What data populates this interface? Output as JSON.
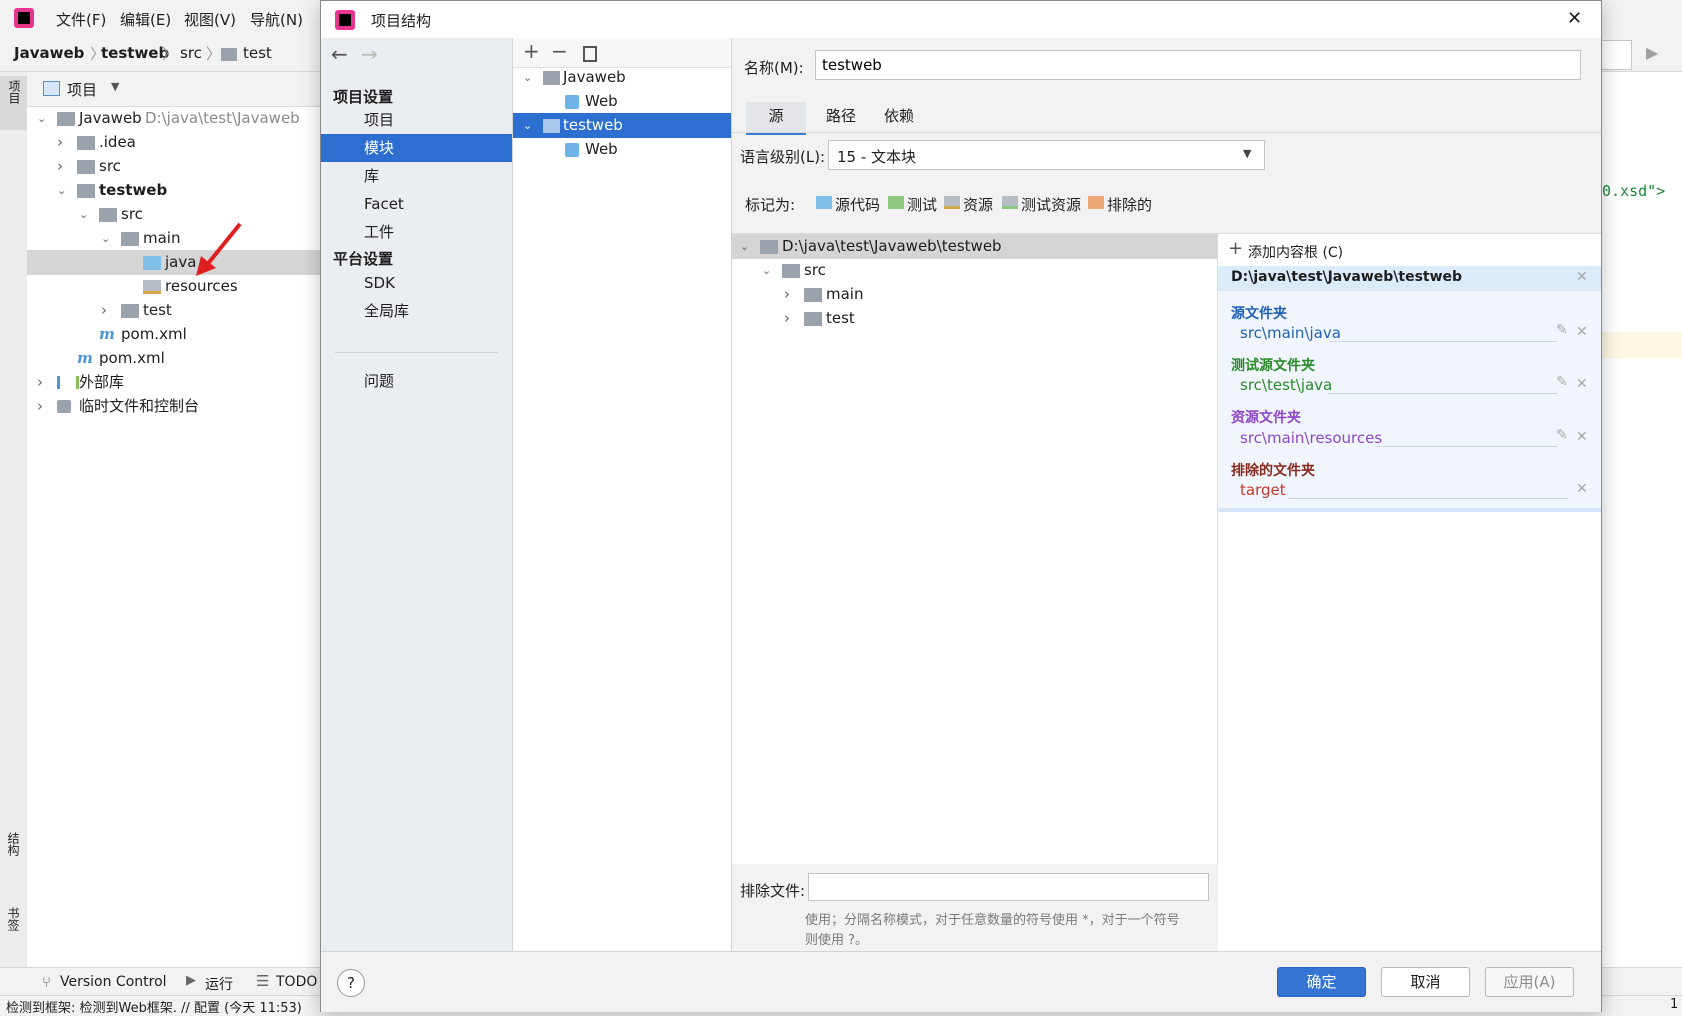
{
  "ide": {
    "menu": [
      "文件(F)",
      "编辑(E)",
      "视图(V)",
      "导航(N)"
    ],
    "breadcrumb": [
      "Javaweb",
      "testweb",
      "src",
      "test"
    ],
    "project_panel_title": "项目",
    "left_strip": {
      "top": "项目",
      "mid": "结构",
      "bottom": "书签"
    },
    "project_tree": [
      {
        "label": "Javaweb",
        "hint": "D:\\java\\test\\Javaweb"
      },
      {
        "label": ".idea"
      },
      {
        "label": "src"
      },
      {
        "label": "testweb"
      },
      {
        "label": "src"
      },
      {
        "label": "main"
      },
      {
        "label": "java"
      },
      {
        "label": "resources"
      },
      {
        "label": "test"
      },
      {
        "label": "pom.xml"
      },
      {
        "label": "pom.xml"
      },
      {
        "label": "外部库"
      },
      {
        "label": "临时文件和控制台"
      }
    ],
    "editor_snippet": "0.xsd\">",
    "bottom_tabs": [
      "Version Control",
      "运行",
      "TODO"
    ],
    "status_text": "检测到框架: 检测到Web框架. // 配置 (今天 11:53)",
    "status_right": "1"
  },
  "dialog": {
    "title": "项目结构",
    "close_label": "✕",
    "nav": {
      "project_settings_header": "项目设置",
      "project_items": [
        "项目",
        "模块",
        "库",
        "Facet",
        "工件"
      ],
      "platform_header": "平台设置",
      "platform_items": [
        "SDK",
        "全局库"
      ],
      "problems": "问题",
      "selected": "模块"
    },
    "modules": [
      {
        "label": "Javaweb"
      },
      {
        "label": "Web"
      },
      {
        "label": "testweb"
      },
      {
        "label": "Web"
      }
    ],
    "name_label": "名称(M):",
    "name_value": "testweb",
    "tabs": [
      "源",
      "路径",
      "依赖"
    ],
    "lang_label": "语言级别(L):",
    "lang_value": "15 - 文本块",
    "mark_as_label": "标记为:",
    "mark_as": [
      {
        "label": "源代码",
        "color": "#7fbfe8"
      },
      {
        "label": "测试",
        "color": "#8ec77e"
      },
      {
        "label": "资源",
        "color": "#b6bcc4"
      },
      {
        "label": "测试资源",
        "color": "#b6bcc4"
      },
      {
        "label": "排除的",
        "color": "#f0a776"
      }
    ],
    "source_tree": [
      {
        "label": "D:\\java\\test\\Javaweb\\testweb"
      },
      {
        "label": "src"
      },
      {
        "label": "main"
      },
      {
        "label": "test"
      }
    ],
    "add_root": "添加内容根 (C)",
    "content_root": "D:\\java\\test\\Javaweb\\testweb",
    "categories": [
      {
        "title": "源文件夹",
        "path": "src\\main\\java",
        "color": "#2160b4"
      },
      {
        "title": "测试源文件夹",
        "path": "src\\test\\java",
        "color": "#2a8a2a"
      },
      {
        "title": "资源文件夹",
        "path": "src\\main\\resources",
        "color": "#8f45c7"
      },
      {
        "title": "排除的文件夹",
        "path": "target",
        "color": "#c0392b",
        "title_color": "#8b2a1e"
      }
    ],
    "exclude_label": "排除文件:",
    "exclude_value": "",
    "exclude_hint_1": "使用；分隔名称模式，对于任意数量的符号使用 *，对于一个符号",
    "exclude_hint_2": "则使用 ?。",
    "help_label": "?",
    "ok_label": "确定",
    "cancel_label": "取消",
    "apply_label": "应用(A)"
  }
}
